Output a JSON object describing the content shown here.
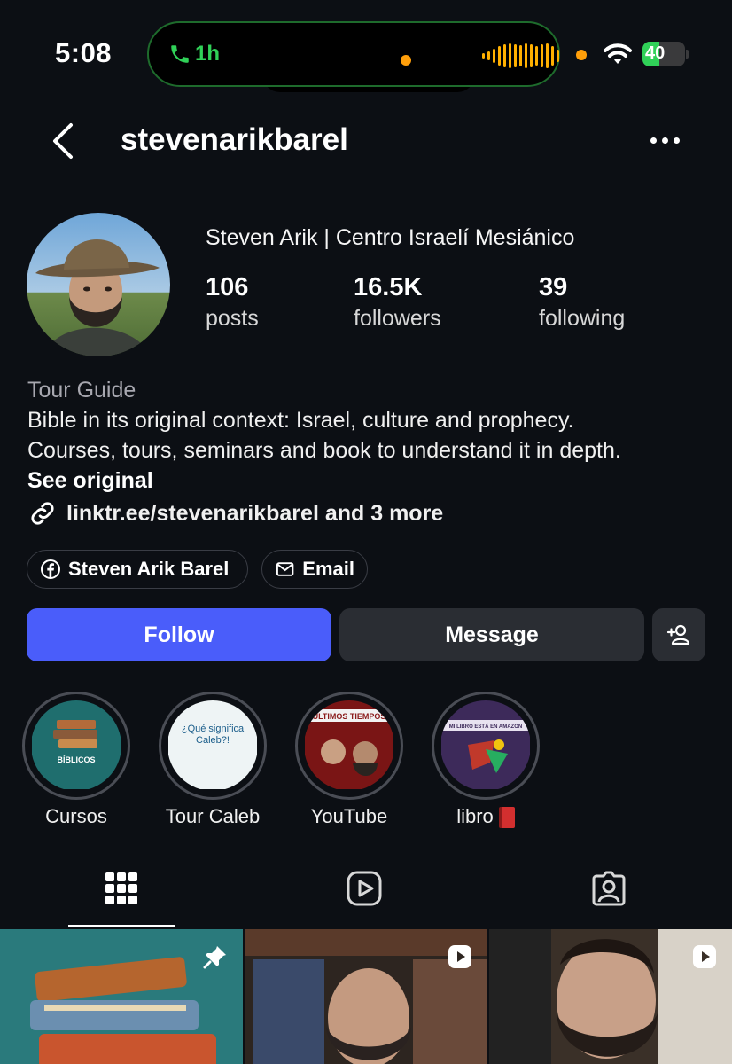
{
  "status_bar": {
    "time": "5:08",
    "call_duration": "1h",
    "battery_percent": "40",
    "battery_level": 0.4
  },
  "header": {
    "username": "stevenarikbarel"
  },
  "profile": {
    "display_name": "Steven Arik | Centro Israelí Mesiánico",
    "stats": [
      {
        "value": "106",
        "label": "posts"
      },
      {
        "value": "16.5K",
        "label": "followers"
      },
      {
        "value": "39",
        "label": "following"
      }
    ],
    "category": "Tour Guide",
    "bio_lines": [
      "Bible in its original context: Israel, culture and prophecy.",
      "Courses, tours, seminars and book to understand it in depth."
    ],
    "see_original": "See original",
    "link_text": "linktr.ee/stevenarikbarel and 3 more"
  },
  "contact_chips": {
    "facebook": "Steven Arik Barel",
    "email": "Email"
  },
  "actions": {
    "follow": "Follow",
    "message": "Message"
  },
  "highlights": [
    {
      "label": "Cursos",
      "cover_text": "BÍBLICOS"
    },
    {
      "label": "Tour Caleb",
      "cover_text": "¿Qué significa Caleb?!"
    },
    {
      "label": "YouTube",
      "cover_text": "ÚLTIMOS TIEMPOS"
    },
    {
      "label": "libro",
      "cover_text": "MI LIBRO ESTÁ EN AMAZON"
    }
  ],
  "colors": {
    "background": "#0c0f14",
    "follow_button": "#4a5dfa",
    "secondary_button": "#2a2d33",
    "call_green": "#30d158",
    "indicator_orange": "#ff9f0a"
  },
  "icons": {
    "back": "chevron-left-icon",
    "more": "more-horizontal-icon",
    "link": "link-icon",
    "facebook": "facebook-icon",
    "email": "envelope-icon",
    "suggest": "add-person-icon",
    "grid_tab": "grid-icon",
    "reels_tab": "play-icon",
    "tagged_tab": "tagged-person-icon",
    "pin": "pin-icon",
    "reel_badge": "reel-badge-icon"
  }
}
